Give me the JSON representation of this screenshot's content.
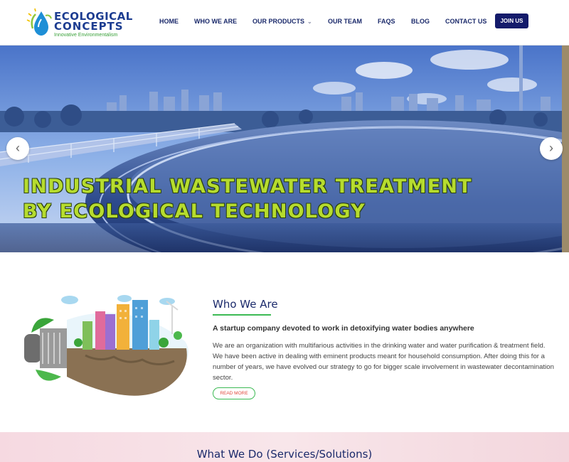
{
  "brand": {
    "name_line1": "ECOLOGICAL",
    "name_line2": "CONCEPTS",
    "tagline": "Innovative Environmentalism"
  },
  "nav": {
    "items": [
      {
        "label": "HOME"
      },
      {
        "label": "WHO WE ARE"
      },
      {
        "label": "OUR PRODUCTS",
        "has_dropdown": true
      },
      {
        "label": "OUR TEAM"
      },
      {
        "label": "FAQS"
      },
      {
        "label": "BLOG"
      },
      {
        "label": "CONTACT US"
      }
    ],
    "join_label": "JOIN US",
    "dropdown_icon": "chevron-down-icon"
  },
  "hero": {
    "title_line1": "INDUSTRIAL WASTEWATER TREATMENT",
    "title_line2": "BY ECOLOGICAL TECHNOLOGY",
    "prev_icon": "chevron-left-icon",
    "next_icon": "chevron-right-icon",
    "prev_glyph": "‹",
    "next_glyph": "›"
  },
  "who": {
    "title": "Who We Are",
    "subtitle": "A startup company devoted to work in detoxifying water bodies anywhere",
    "body": "We are an organization with multifarious activities in the drinking water and water purification & treatment field. We have been active in dealing with eminent products meant for household consumption. After doing this for a number of years, we have evolved our strategy to go for bigger scale involvement in wastewater decontamination sector.",
    "read_more": "READ MORE"
  },
  "services": {
    "title": "What We Do (Services/Solutions)"
  },
  "colors": {
    "brand_navy": "#1b2a6b",
    "accent_green": "#3cba54",
    "hero_text": "#b6dc2e",
    "join_bg": "#141b6b"
  }
}
